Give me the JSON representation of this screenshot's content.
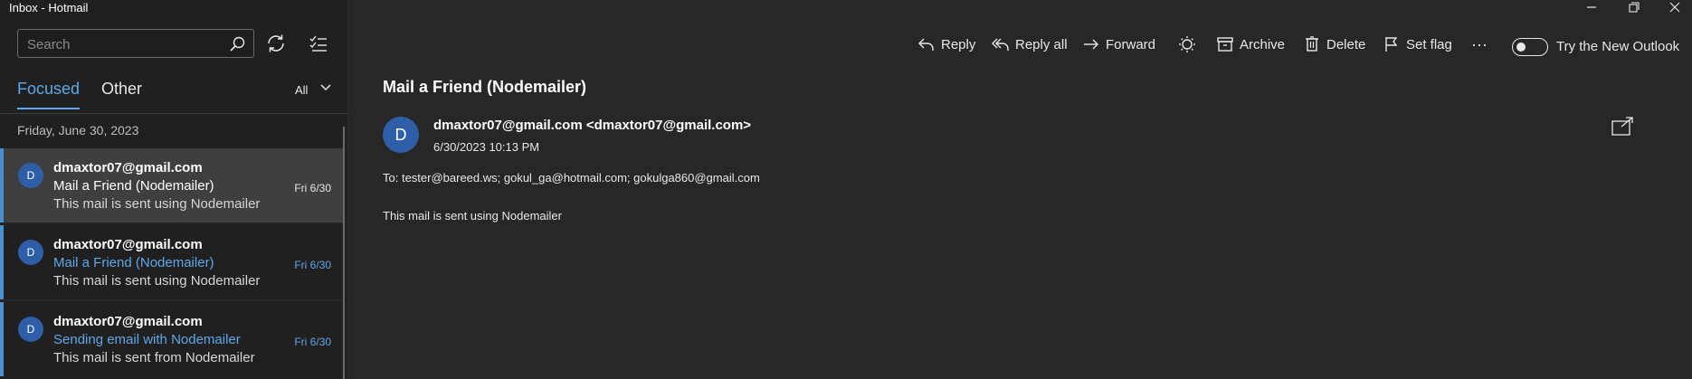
{
  "window": {
    "title": "Inbox - Hotmail"
  },
  "search": {
    "placeholder": "Search"
  },
  "tabs": {
    "focused": "Focused",
    "other": "Other"
  },
  "filter": {
    "label": "All"
  },
  "message_list": {
    "group_date": "Friday, June 30, 2023",
    "messages": [
      {
        "avatar": "D",
        "from": "dmaxtor07@gmail.com",
        "subject": "Mail a Friend (Nodemailer)",
        "preview": "This mail is sent using Nodemailer",
        "date": "Fri 6/30"
      },
      {
        "avatar": "D",
        "from": "dmaxtor07@gmail.com",
        "subject": "Mail a Friend (Nodemailer)",
        "preview": "This mail is sent using Nodemailer",
        "date": "Fri 6/30"
      },
      {
        "avatar": "D",
        "from": "dmaxtor07@gmail.com",
        "subject": "Sending email with Nodemailer",
        "preview": "This mail is sent from Nodemailer",
        "date": "Fri 6/30"
      }
    ]
  },
  "toolbar": {
    "reply": "Reply",
    "reply_all": "Reply all",
    "forward": "Forward",
    "archive": "Archive",
    "delete": "Delete",
    "set_flag": "Set flag",
    "more": "···",
    "new_outlook": "Try the New Outlook"
  },
  "reading": {
    "subject": "Mail a Friend (Nodemailer)",
    "avatar": "D",
    "sender": "dmaxtor07@gmail.com  <dmaxtor07@gmail.com>",
    "sent": "6/30/2023 10:13 PM",
    "to": "To: tester@bareed.ws; gokul_ga@hotmail.com; gokulga860@gmail.com",
    "body": "This mail is sent using Nodemailer"
  },
  "colors": {
    "accent": "#5fa8e8",
    "avatar": "#2f5ea8",
    "background": "#272727",
    "sidebar": "#202020"
  }
}
